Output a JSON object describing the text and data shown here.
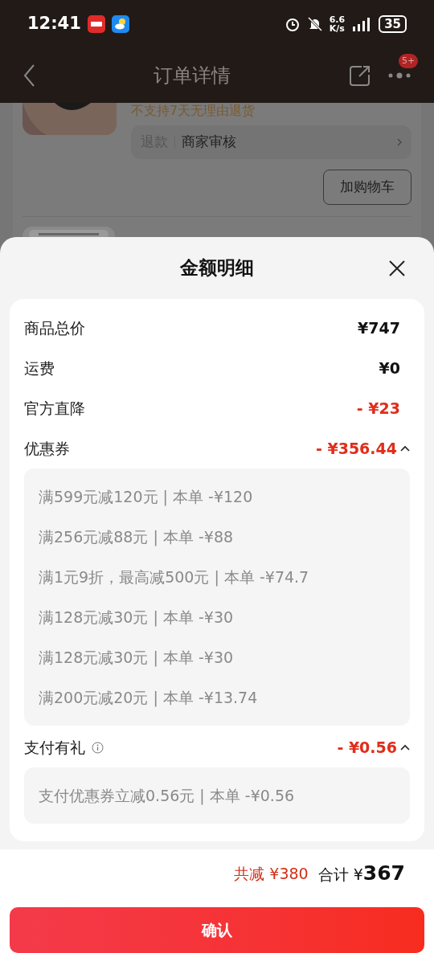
{
  "status_bar": {
    "time": "12:41",
    "speed_value": "6.6",
    "speed_unit": "K/s",
    "battery": "35"
  },
  "header": {
    "title": "订单详情",
    "badge": "5+"
  },
  "order_behind": {
    "return_policy": "不支持7天无理由退货",
    "refund_label": "退款",
    "refund_status": "商家审核",
    "add_to_cart": "加购物车"
  },
  "sheet": {
    "title": "金额明细",
    "rows": [
      {
        "label": "商品总价",
        "value": "¥747",
        "highlight": false
      },
      {
        "label": "运费",
        "value": "¥0",
        "highlight": false
      },
      {
        "label": "官方直降",
        "value": "- ¥23",
        "highlight": true
      },
      {
        "label": "优惠券",
        "value": "- ¥356.44",
        "highlight": true,
        "expanded": true,
        "details": [
          "满599元减120元 | 本单 -¥120",
          "满256元减88元 | 本单 -¥88",
          "满1元9折，最高减500元 | 本单 -¥74.7",
          "满128元减30元 | 本单 -¥30",
          "满128元减30元 | 本单 -¥30",
          "满200元减20元 | 本单 -¥13.74"
        ]
      },
      {
        "label": "支付有礼",
        "value": "- ¥0.56",
        "highlight": true,
        "info": true,
        "expanded": true,
        "details": [
          "支付优惠券立减0.56元 | 本单 -¥0.56"
        ]
      }
    ]
  },
  "footer": {
    "saved_label": "共减",
    "saved_value": "¥380",
    "total_label": "合计",
    "total_currency": "¥",
    "total_value": "367",
    "confirm": "确认"
  }
}
